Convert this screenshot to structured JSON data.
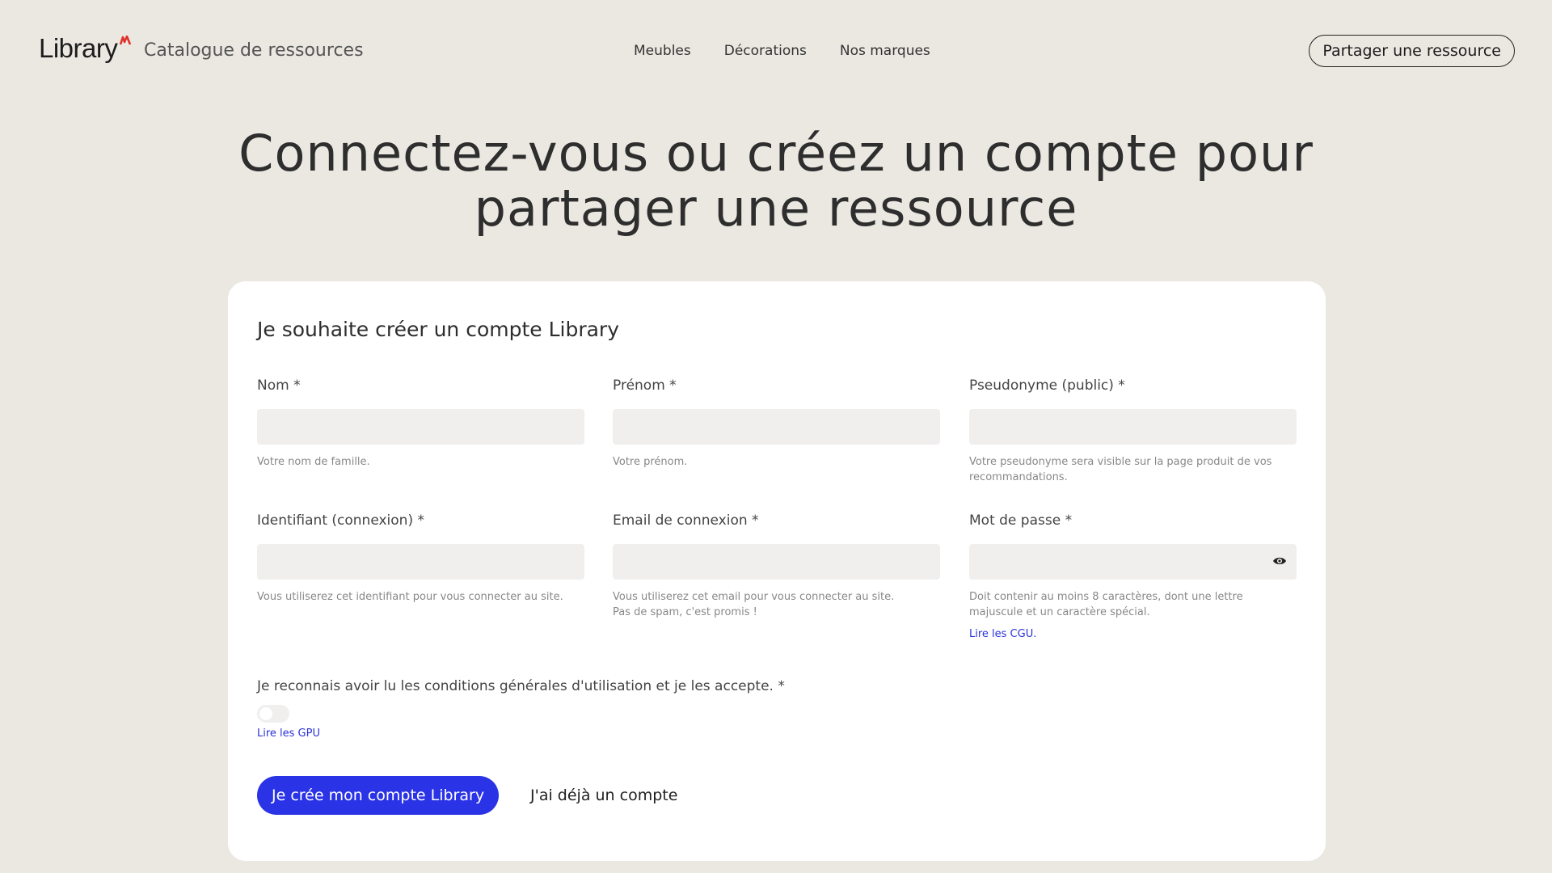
{
  "header": {
    "brand": "Library",
    "subtitle": "Catalogue de ressources",
    "nav": [
      "Meubles",
      "Décorations",
      "Nos marques"
    ],
    "share_label": "Partager une ressource",
    "accent_color": "#e0322b"
  },
  "hero": {
    "line1": "Connectez-vous ou créez un compte pour",
    "line2": "partager une ressource"
  },
  "form": {
    "title": "Je souhaite créer un compte Library",
    "fields": {
      "nom": {
        "label": "Nom *",
        "value": "",
        "hint": "Votre nom de famille."
      },
      "prenom": {
        "label": "Prénom *",
        "value": "",
        "hint": "Votre prénom."
      },
      "pseudo": {
        "label": "Pseudonyme (public) *",
        "value": "",
        "hint": "Votre pseudonyme sera visible sur la page produit de vos recommandations."
      },
      "identifiant": {
        "label": "Identifiant (connexion) *",
        "value": "",
        "hint": "Vous utiliserez cet identifiant pour vous connecter au site."
      },
      "email": {
        "label": "Email de connexion *",
        "value": "",
        "hint1": "Vous utiliserez cet email pour vous connecter au site.",
        "hint2": "Pas de spam, c'est promis !"
      },
      "password": {
        "label": "Mot de passe *",
        "value": "",
        "hint": "Doit contenir au moins 8 caractères, dont une lettre majuscule et un caractère spécial.",
        "link": "Lire les CGU.",
        "icon": "eye-icon"
      }
    },
    "cgu_label": "Je reconnais avoir lu les conditions générales d'utilisation et je les accepte. *",
    "cgu_toggle_on": false,
    "gpu_link": "Lire les GPU",
    "submit_label": "Je crée mon compte Library",
    "login_label": "J'ai déjà un compte",
    "primary_color": "#2a33e5"
  }
}
